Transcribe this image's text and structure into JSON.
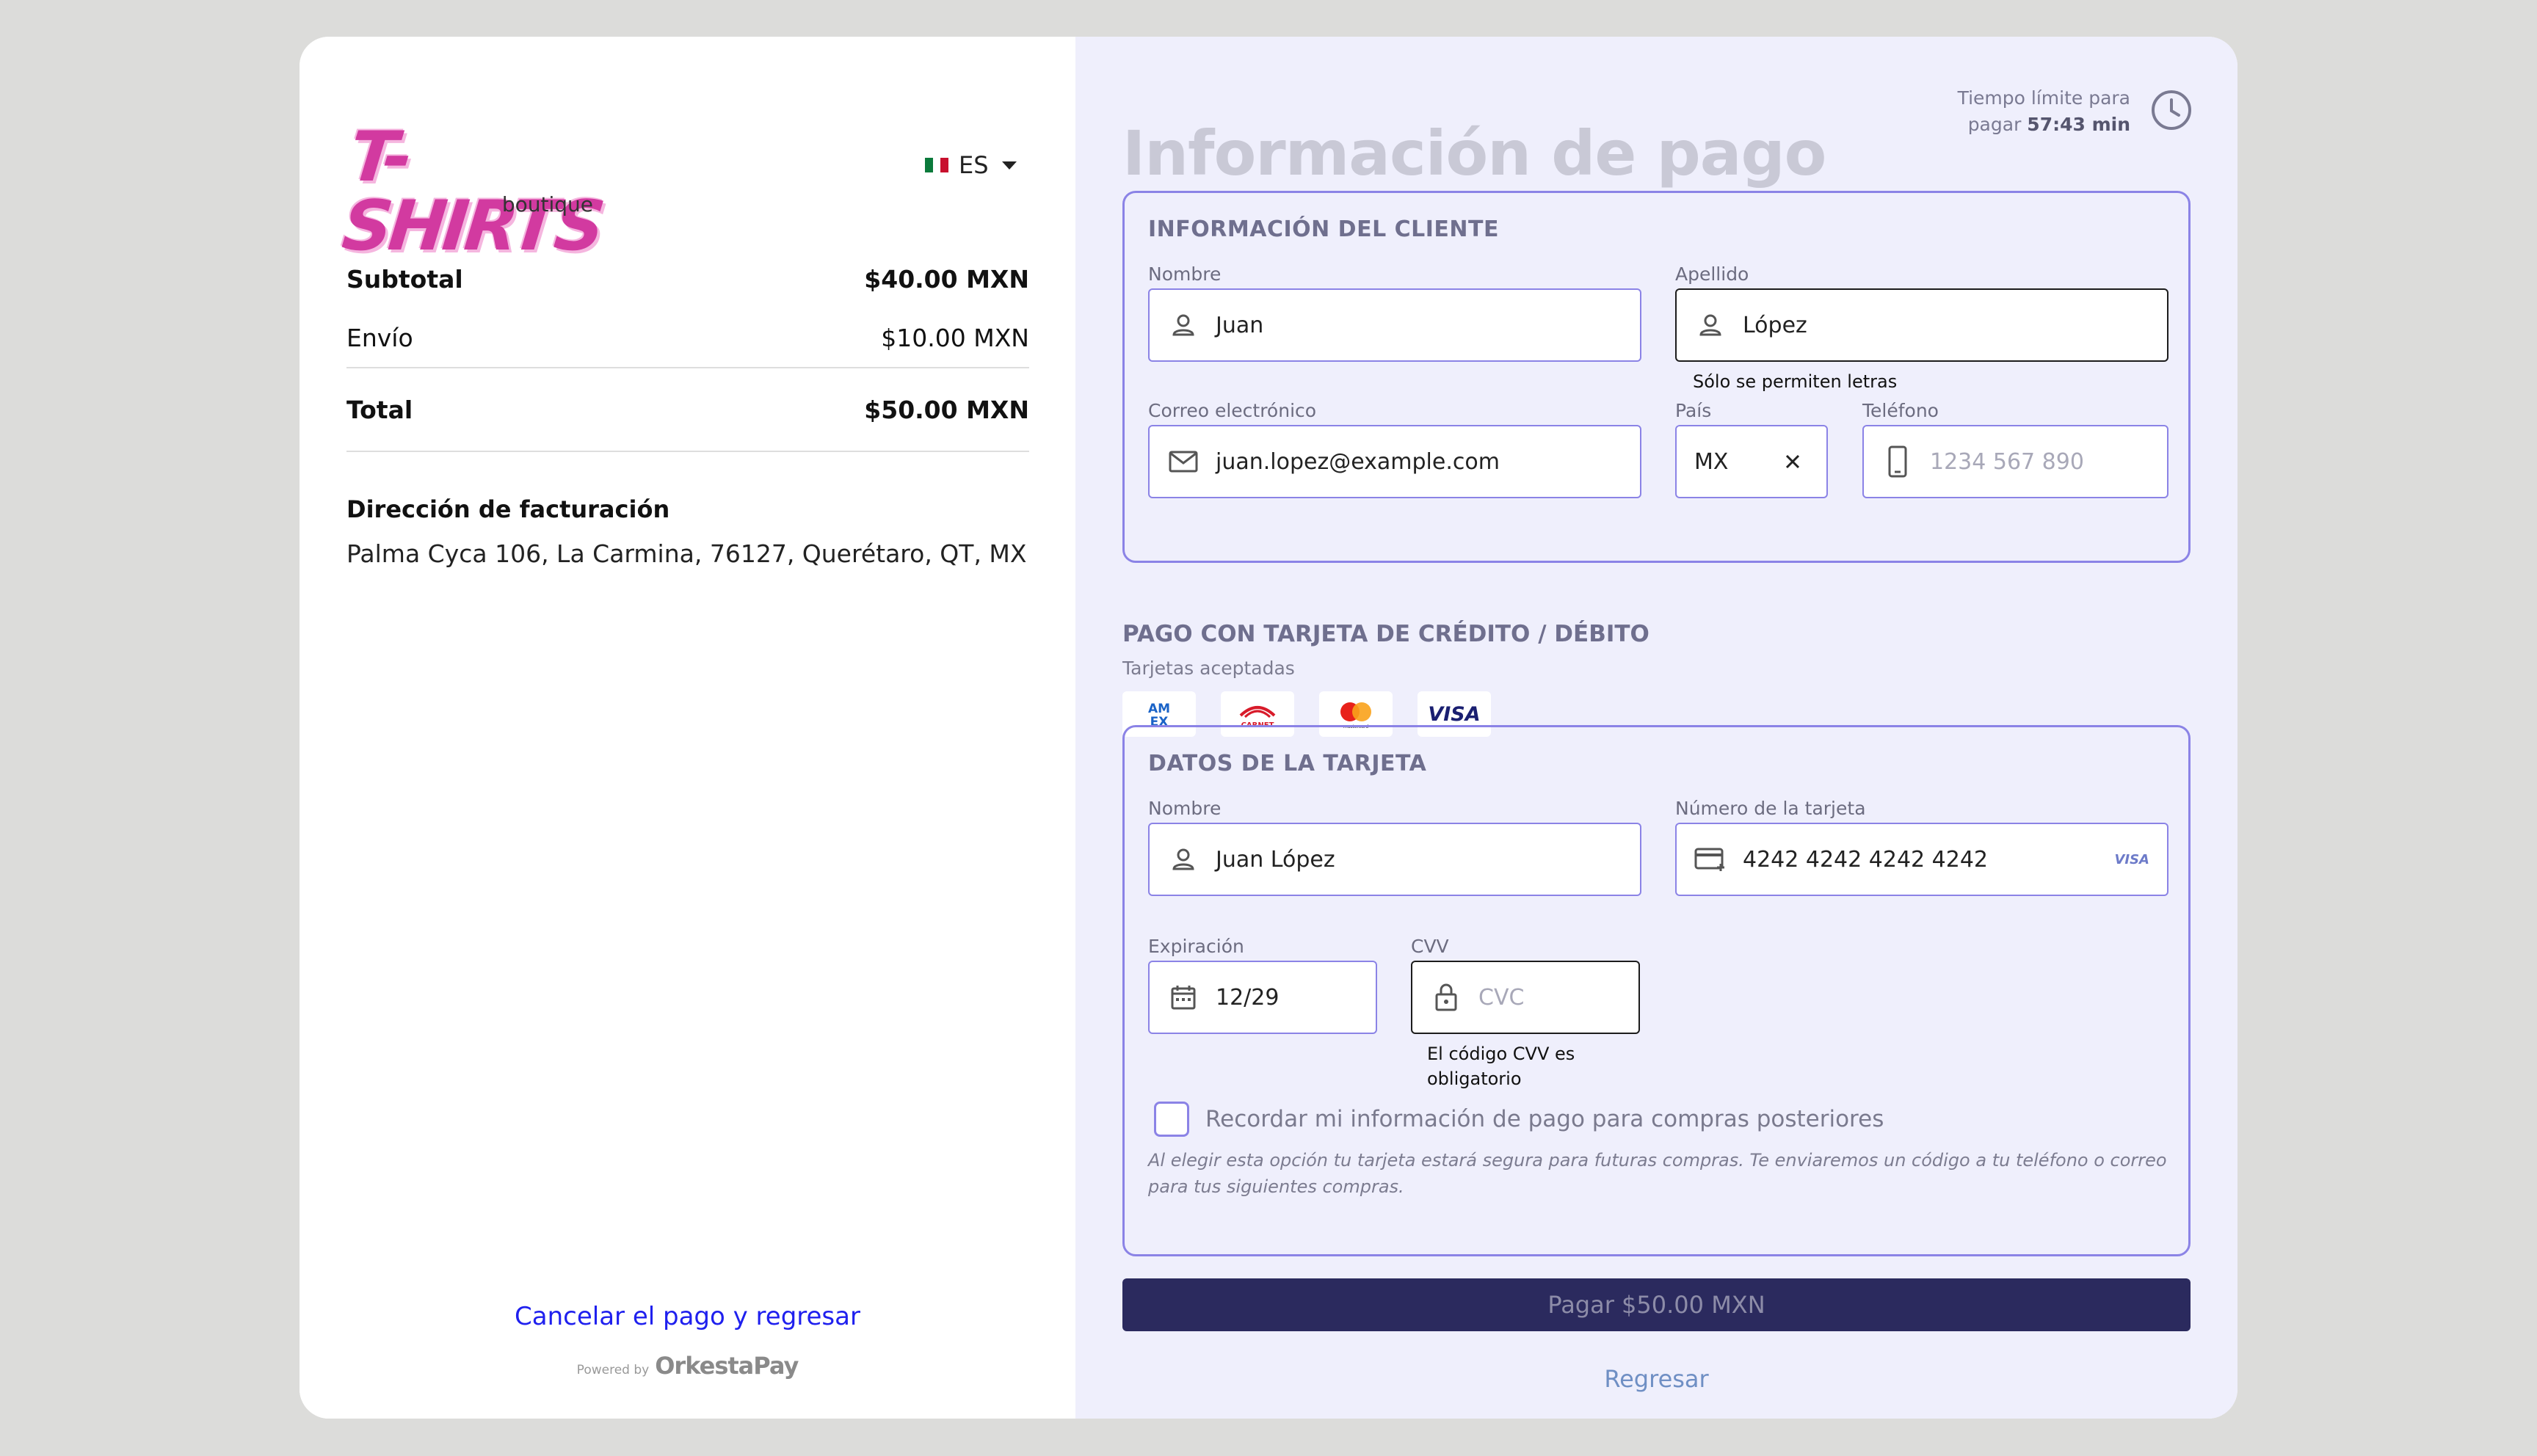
{
  "brand": {
    "logo_text": "T-SHIRTS",
    "logo_sub": "boutique"
  },
  "language": {
    "selected": "ES"
  },
  "summary": {
    "subtotal_label": "Subtotal",
    "subtotal_value": "$40.00 MXN",
    "shipping_label": "Envío",
    "shipping_value": "$10.00 MXN",
    "total_label": "Total",
    "total_value": "$50.00 MXN"
  },
  "billing": {
    "title": "Dirección de facturación",
    "address": "Palma Cyca 106, La Carmina, 76127, Querétaro, QT, MX"
  },
  "footer": {
    "cancel_link": "Cancelar el pago y regresar",
    "powered_by": "Powered by",
    "powered_brand": "OrkestaPay"
  },
  "payment": {
    "title": "Información de pago",
    "timer_line1": "Tiempo límite para",
    "timer_prefix": "pagar",
    "timer_value": "57:43 min"
  },
  "customer": {
    "section_title": "INFORMACIÓN DEL CLIENTE",
    "first_name_label": "Nombre",
    "first_name_value": "Juan",
    "last_name_label": "Apellido",
    "last_name_value": "López",
    "last_name_hint": "Sólo se permiten letras",
    "email_label": "Correo electrónico",
    "email_value": "juan.lopez@example.com",
    "country_label": "País",
    "country_value": "MX",
    "phone_label": "Teléfono",
    "phone_placeholder": "1234 567 890"
  },
  "card_payment": {
    "heading": "PAGO CON TARJETA DE CRÉDITO / DÉBITO",
    "accepted_label": "Tarjetas aceptadas",
    "brands": [
      "AMEX",
      "CARNET",
      "mastercard",
      "VISA"
    ]
  },
  "card": {
    "section_title": "DATOS DE LA TARJETA",
    "name_label": "Nombre",
    "name_value": "Juan López",
    "number_label": "Número de la tarjeta",
    "number_value": "4242 4242 4242 4242",
    "number_brand": "VISA",
    "expiry_label": "Expiración",
    "expiry_value": "12/29",
    "cvv_label": "CVV",
    "cvv_placeholder": "CVC",
    "cvv_hint": "El código CVV es obligatorio",
    "remember_label": "Recordar mi información de pago para compras posteriores",
    "remember_note": "Al elegir esta opción tu tarjeta estará segura para futuras compras. Te enviaremos un código a tu teléfono o correo para tus siguientes compras."
  },
  "actions": {
    "pay_label": "Pagar $50.00 MXN",
    "back_label": "Regresar"
  },
  "colors": {
    "accent": "#8b83e6",
    "pay_button": "#2b2a5e",
    "link": "#1f20ee",
    "logo": "#d23aa0",
    "panel": "#efeffc"
  }
}
